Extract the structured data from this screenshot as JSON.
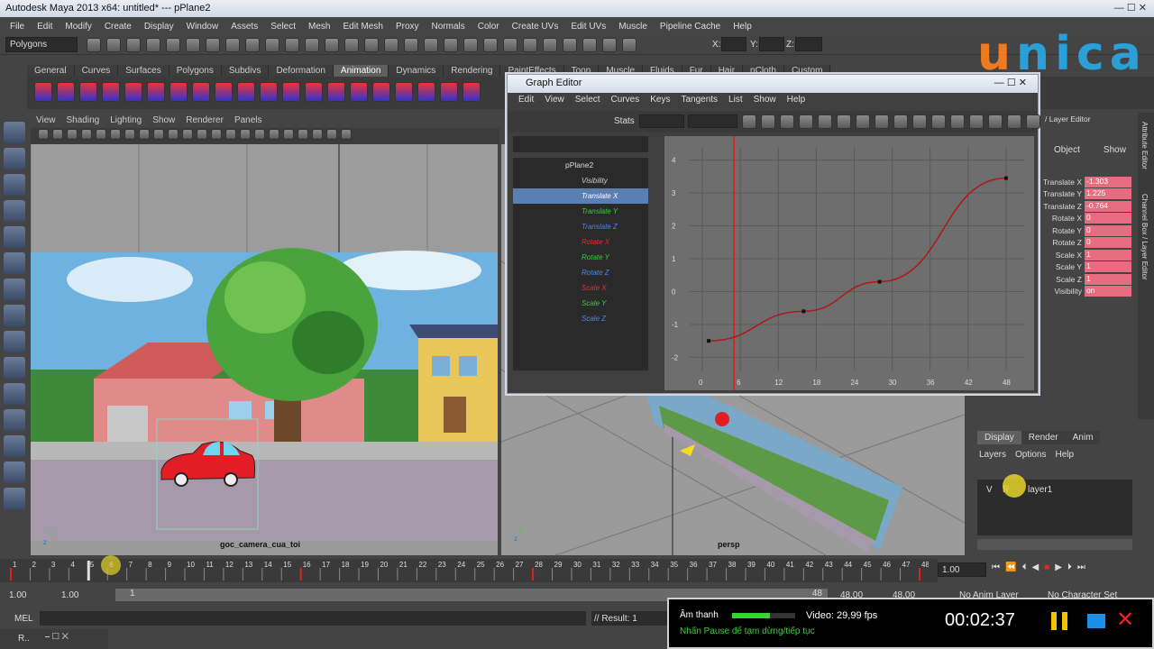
{
  "window": {
    "title": "Autodesk Maya 2013 x64: untitled*   ---   pPlane2"
  },
  "menubar": [
    "File",
    "Edit",
    "Modify",
    "Create",
    "Display",
    "Window",
    "Assets",
    "Select",
    "Mesh",
    "Edit Mesh",
    "Proxy",
    "Normals",
    "Color",
    "Create UVs",
    "Edit UVs",
    "Muscle",
    "Pipeline Cache",
    "Help"
  ],
  "status": {
    "menuset": "Polygons",
    "x_label": "X:",
    "y_label": "Y:",
    "z_label": "Z:"
  },
  "shelf_tabs": [
    "General",
    "Curves",
    "Surfaces",
    "Polygons",
    "Subdivs",
    "Deformation",
    "Animation",
    "Dynamics",
    "Rendering",
    "PaintEffects",
    "Toon",
    "Muscle",
    "Fluids",
    "Fur",
    "Hair",
    "nCloth",
    "Custom"
  ],
  "shelf_active": "Animation",
  "viewport_menu": [
    "View",
    "Shading",
    "Lighting",
    "Show",
    "Renderer",
    "Panels"
  ],
  "viewport1": {
    "camera": "goc_camera_cua_toi"
  },
  "viewport2": {
    "camera": "persp"
  },
  "watermark": {
    "letters": [
      "u",
      "n",
      "i",
      "c",
      "a"
    ],
    "colors": [
      "#f07a1f",
      "#2a9fd8",
      "#2a9fd8",
      "#2a9fd8",
      "#2a9fd8"
    ]
  },
  "graph_editor": {
    "title": "Graph Editor",
    "menu": [
      "Edit",
      "View",
      "Select",
      "Curves",
      "Keys",
      "Tangents",
      "List",
      "Show",
      "Help"
    ],
    "stats_label": "Stats",
    "outliner_root": "pPlane2",
    "channels": [
      {
        "name": "Visibility",
        "color": "#cccccc"
      },
      {
        "name": "Translate X",
        "color": "#ffffff",
        "selected": true
      },
      {
        "name": "Translate Y",
        "color": "#34d13b"
      },
      {
        "name": "Translate Z",
        "color": "#4a86e8"
      },
      {
        "name": "Rotate X",
        "color": "#e03030"
      },
      {
        "name": "Rotate Y",
        "color": "#34d13b"
      },
      {
        "name": "Rotate Z",
        "color": "#4a86e8"
      },
      {
        "name": "Scale X",
        "color": "#e03030"
      },
      {
        "name": "Scale Y",
        "color": "#34d13b"
      },
      {
        "name": "Scale Z",
        "color": "#4a86e8"
      }
    ]
  },
  "chart_data": {
    "type": "line",
    "title": "",
    "x_ticks": [
      0,
      6,
      12,
      18,
      24,
      30,
      36,
      42,
      48
    ],
    "y_ticks": [
      4,
      3,
      2,
      1,
      0,
      -1,
      -2
    ],
    "xlim": [
      -2,
      51
    ],
    "ylim": [
      -2.4,
      4.4
    ],
    "current_frame": 5,
    "series": [
      {
        "color": "#b01818",
        "keys": [
          {
            "x": 1,
            "y": -1.5
          },
          {
            "x": 16,
            "y": -0.6
          },
          {
            "x": 28,
            "y": 0.3
          },
          {
            "x": 48,
            "y": 3.45
          }
        ]
      }
    ]
  },
  "channel_box": {
    "header": "/ Layer Editor",
    "tabs": [
      "Object",
      "Show"
    ],
    "rows": [
      {
        "label": "Translate X",
        "value": "-1.303"
      },
      {
        "label": "Translate Y",
        "value": "1.225"
      },
      {
        "label": "Translate Z",
        "value": "-0.764"
      },
      {
        "label": "Rotate X",
        "value": "0"
      },
      {
        "label": "Rotate Y",
        "value": "0"
      },
      {
        "label": "Rotate Z",
        "value": "0"
      },
      {
        "label": "Scale X",
        "value": "1"
      },
      {
        "label": "Scale Y",
        "value": "1"
      },
      {
        "label": "Scale Z",
        "value": "1"
      },
      {
        "label": "Visibility",
        "value": "on"
      }
    ],
    "side_labels": [
      "Attribute Editor",
      "Channel Box / Layer Editor"
    ]
  },
  "layers": {
    "tabs": [
      "Display",
      "Render",
      "Anim"
    ],
    "menu": [
      "Layers",
      "Options",
      "Help"
    ],
    "row_v": "V",
    "row_r": "R",
    "layer_name": "layer1"
  },
  "timeline": {
    "ticks": [
      "1",
      "2",
      "3",
      "4",
      "5",
      "6",
      "7",
      "8",
      "9",
      "10",
      "11",
      "12",
      "13",
      "14",
      "15",
      "16",
      "17",
      "18",
      "19",
      "20",
      "21",
      "22",
      "23",
      "24",
      "25",
      "26",
      "27",
      "28",
      "29",
      "30",
      "31",
      "32",
      "33",
      "34",
      "35",
      "36",
      "37",
      "38",
      "39",
      "40",
      "41",
      "42",
      "43",
      "44",
      "45",
      "46",
      "47",
      "48"
    ],
    "current": "5",
    "field": "1.00"
  },
  "range": {
    "start": "1.00",
    "start2": "1.00",
    "current": "1",
    "end_a": "48",
    "end": "48.00",
    "end_b": "48.00",
    "anim_layer": "No Anim Layer",
    "char_set": "No Character Set"
  },
  "mel": {
    "label": "MEL",
    "result": "// Result: 1"
  },
  "taskbar": {
    "label": "R.."
  },
  "player": {
    "audio": "Âm thanh",
    "video": "Video: 29,99 fps",
    "hint": "Nhấn Pause để tạm dừng/tiếp tục",
    "time": "00:02:37"
  }
}
